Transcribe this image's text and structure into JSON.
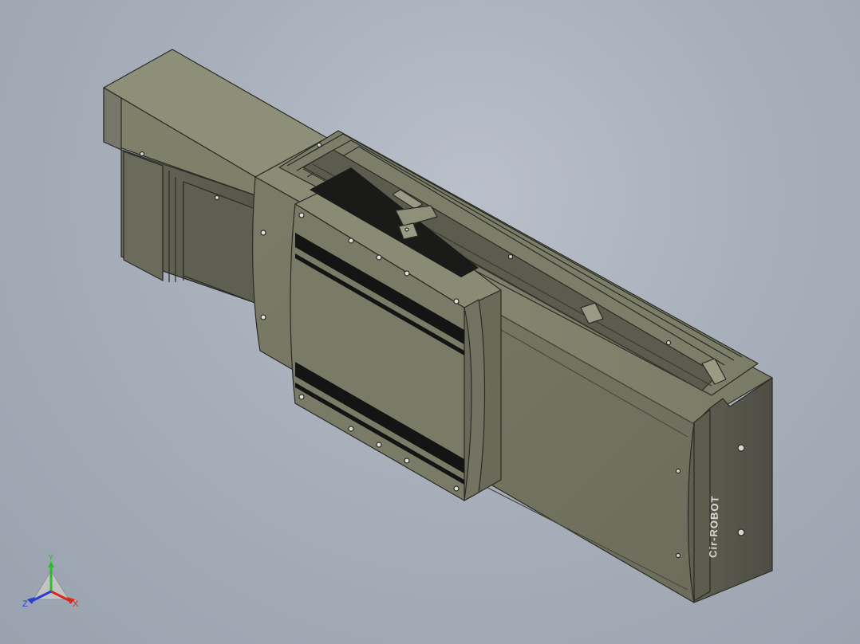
{
  "model": {
    "brand_logo": "Cir-ROBOT",
    "colors": {
      "background": "#a7afba",
      "body_light": "#84846f",
      "body_mid": "#6f6f5d",
      "body_dark": "#55554a",
      "edge": "#2b2b26",
      "strip": "#141414"
    }
  },
  "triad": {
    "x_label": "X",
    "y_label": "Y",
    "z_label": "Z",
    "x_color": "#d42a1e",
    "y_color": "#2bbd2b",
    "z_color": "#2b3ed4"
  }
}
